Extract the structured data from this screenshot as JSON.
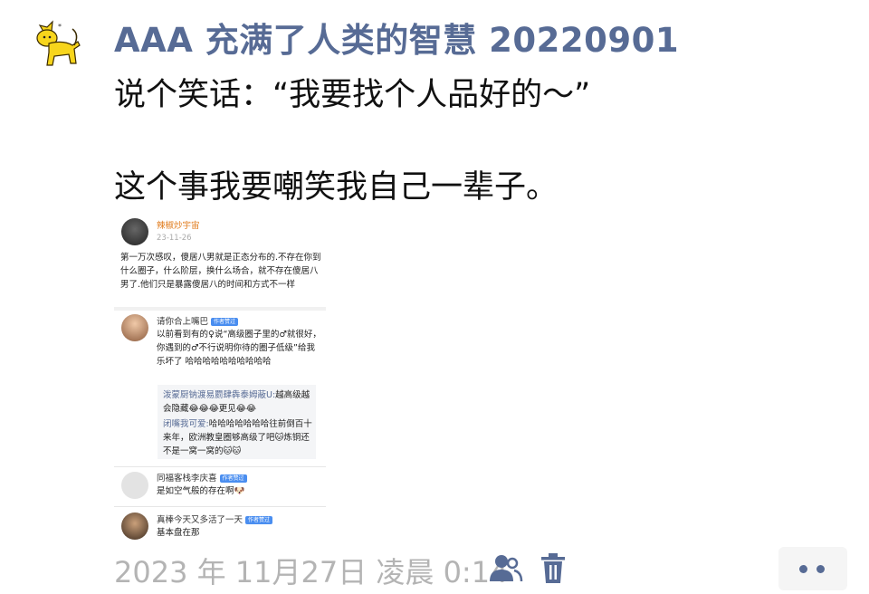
{
  "post": {
    "author": "AAA 充满了人类的智慧 20220901",
    "line1": "说个笑话：“我要找个人品好的～”",
    "line2": "这个事我要嘲笑我自己一辈子。"
  },
  "screenshot": {
    "post_author": "辣椒炒宇宙",
    "post_date": "23-11-26",
    "post_text": "第一万次感叹，傻居八男就是正态分布的.不存在你到什么圈子，什么阶层，换什么场合，就不存在傻居八男了.他们只是暴露傻居八的时间和方式不一样",
    "c1_name": "请你合上嘴巴",
    "c1_tag": "作者赞过",
    "c1_text": "以前看到有的♀说“高级圈子里的♂就很好，你遇到的♂不行说明你待的圈子低级”给我乐坏了 哈哈哈哈哈哈哈哈哈哈",
    "r1_name": "泼蒙厨钠渡易罽肆犇泰姆蔽U:",
    "r1_text": "越高级越会隐藏😂😂😂更见😂😂",
    "r2_name": "闭嘴我可爱:",
    "r2_text": "哈哈哈哈哈哈哈往前倒百十来年，欧洲教皇圈够高级了吧🐱炼铜还不是一窝一窝的🐱🐱",
    "c2_name": "同福客栈李庆喜",
    "c2_tag": "作者赞过",
    "c2_text": "是如空气般的存在啊🐶",
    "c3_name": "真棒今天又多活了一天",
    "c3_tag": "作者赞过",
    "c3_text": "基本盘在那"
  },
  "footer": {
    "timestamp": "2023 年 11月27日 凌晨 0:14"
  },
  "icons": {
    "avatar": "cat-icon",
    "visibility": "person-icon",
    "delete": "trash-icon",
    "more": "more-dots-icon"
  },
  "colors": {
    "author_name": "#576b95",
    "timestamp": "#b4b4b4",
    "cat_yellow": "#f7d51c"
  }
}
